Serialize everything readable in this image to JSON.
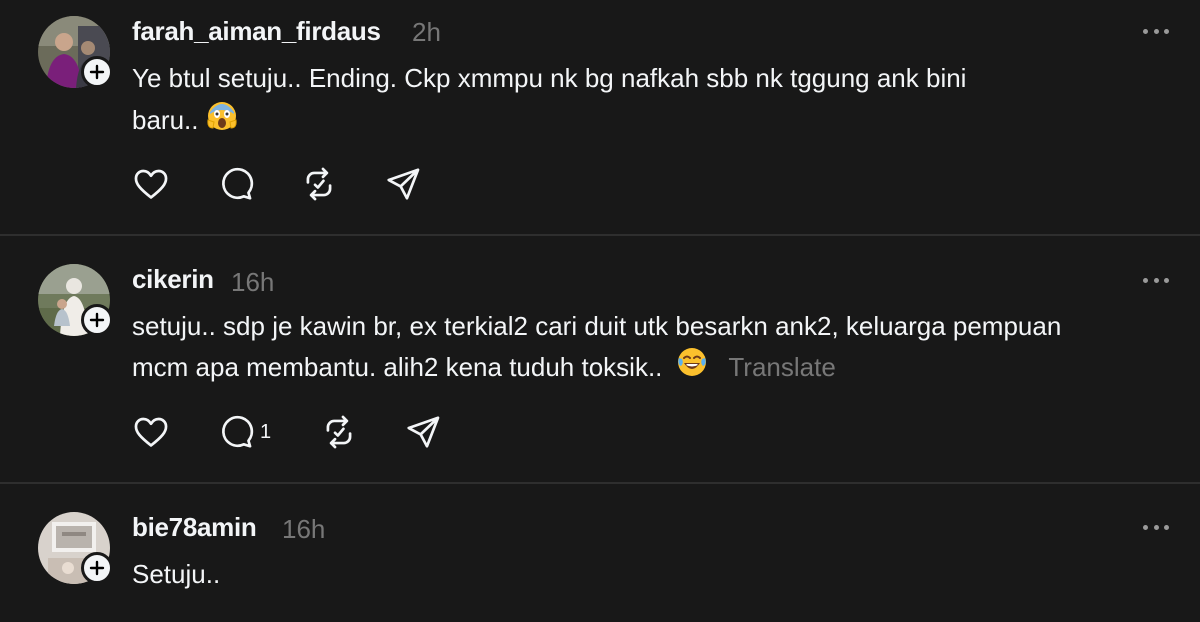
{
  "posts": [
    {
      "username": "farah_aiman_firdaus",
      "time": "2h",
      "text_line1": "Ye btul setuju.. Ending. Ckp xmmpu nk bg nafkah sbb nk tggung ank bini",
      "text_line2": "baru..",
      "emoji": "screaming-face",
      "reply_count": ""
    },
    {
      "username": "cikerin",
      "time": "16h",
      "text_line1": "setuju.. sdp je kawin br, ex terkial2 cari duit utk besarkn ank2, keluarga pempuan",
      "text_line2": "mcm apa membantu. alih2 kena tuduh toksik..",
      "emoji": "laughing-tears-face",
      "translate_label": "Translate",
      "reply_count": "1"
    },
    {
      "username": "bie78amin",
      "time": "16h",
      "text_line1": "Setuju..",
      "reply_count": ""
    }
  ],
  "icons": {
    "like": "heart-icon",
    "reply": "comment-icon",
    "repost": "repost-icon",
    "share": "send-icon",
    "more": "more-dots-icon",
    "follow": "plus-icon"
  },
  "colors": {
    "background": "#181818",
    "text": "#f3f5f7",
    "secondary": "#777777",
    "divider": "#2e2e2e"
  }
}
